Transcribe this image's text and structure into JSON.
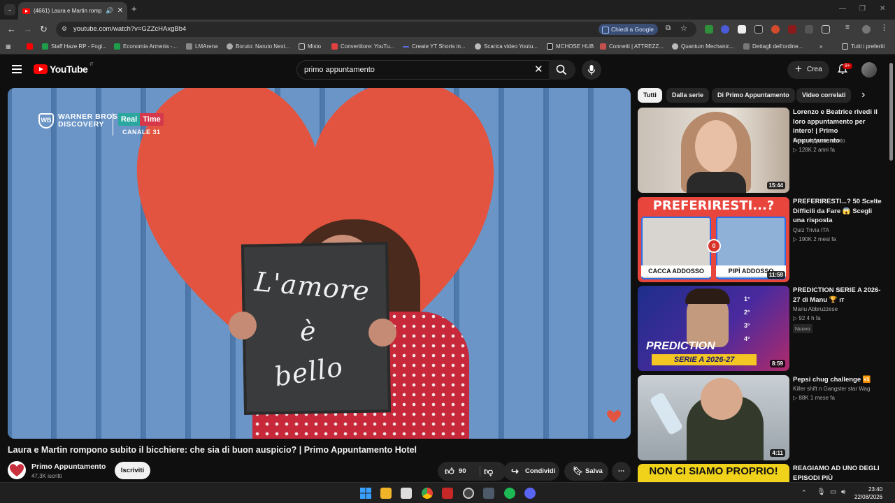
{
  "browser": {
    "tab_title": "(4661) Laura e Martin romp",
    "url": "youtube.com/watch?v=GZZcHAxgBb4",
    "chiedi": "Chiedi a Google",
    "bookmarks": [
      "Staff Haze RP - Fogl...",
      "Economia Armeria -...",
      "LMArena",
      "Boruto: Naruto Next...",
      "Misto",
      "Convertitore: YouTu...",
      "Create YT Shorts in...",
      "Scarica video Youtu...",
      "MCHOSE HUB",
      "Connetti | ATTREZZ...",
      "Quantum Mechanic...",
      "Dettagli dell'ordine..."
    ],
    "all_bookmarks": "Tutti i preferiti"
  },
  "header": {
    "logo_text": "YouTube",
    "logo_country": "IT",
    "search_query": "primo appuntamento",
    "create_label": "Crea",
    "notif_badge": "9+"
  },
  "video": {
    "brand": "WARNER BROS. DISCOVERY",
    "network_real": "Real",
    "network_time": "Time",
    "channel_number": "CANALE 31",
    "board_line1": "L'amore",
    "board_line2": "è",
    "board_line3": "bello",
    "title": "Laura e Martin rompono subito il bicchiere: che sia di buon auspicio? | Primo Appuntamento Hotel"
  },
  "channel": {
    "name": "Primo Appuntamento",
    "subs": "47,3K iscritti",
    "subscribe_label": "Iscriviti"
  },
  "actions": {
    "likes": "90",
    "share": "Condividi",
    "save": "Salva"
  },
  "chips": [
    "Tutti",
    "Dalla serie",
    "Di Primo Appuntamento",
    "Video correlati"
  ],
  "recs": [
    {
      "title": "Lorenzo e Beatrice rivedi il loro appuntamento per intero! | Primo Appuntamento",
      "channel": "Primo Appuntamento",
      "stats": "▷ 128K   2 anni fa",
      "duration": "15:44"
    },
    {
      "title": "PREFERIRESTI...? 50 Scelte Difficili da Fare 😱 Scegli una risposta",
      "channel": "Quiz Trivia ITA",
      "stats": "▷ 190K   2 mesi fa",
      "duration": "11:59",
      "thumb_title": "PREFERIRESTI...?",
      "left": "CACCA ADDOSSO",
      "right": "PIPÌ ADDOSSO",
      "mid": "0"
    },
    {
      "title": "PREDICTION SERIE A 2026-27 di Manu 🏆 ıт",
      "channel": "Manu Abbruzzese",
      "stats": "▷ 92   4 h fa",
      "duration": "8:59",
      "badge": "Nuovo",
      "thumb_title": "PREDICTION",
      "thumb_sub": "SERIE A 2026-27",
      "ranks": [
        "1°",
        "2°",
        "3°",
        "4°"
      ]
    },
    {
      "title": "Pepsi chug challenge 🆚",
      "channel": "Killer shift n Gangster star Wag",
      "stats": "▷ 88K   1 mese fa",
      "duration": "4:11"
    },
    {
      "title": "REAGIAMO AD UNO DEGLI EPISODI PIÙ IMBARAZZANTI",
      "thumb_title": "NON CI SIAMO PROPRIO!"
    }
  ],
  "taskbar": {
    "time": "23:40",
    "date": "22/08/2026"
  }
}
